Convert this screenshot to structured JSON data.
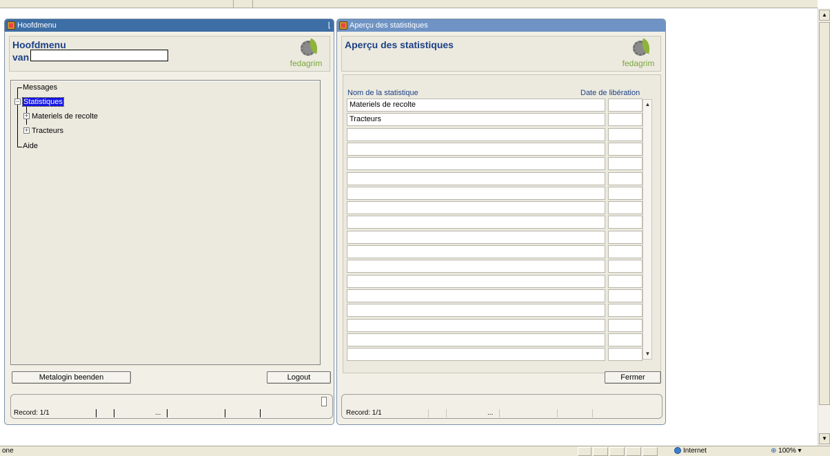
{
  "left_window": {
    "title": "Hoofdmenu",
    "heading_line1": "Hoofdmenu",
    "heading_line2": "van",
    "logo_text": "fedagrim",
    "tree": {
      "messages": "Messages",
      "statistiques": "Statistiques",
      "materiels": "Materiels de recolte",
      "tracteurs": "Tracteurs",
      "aide": "Aide"
    },
    "button_metalogin": "Metalogin beenden",
    "button_logout": "Logout",
    "record": "Record: 1/1",
    "record_dots": "..."
  },
  "right_window": {
    "title": "Aperçu des statistiques",
    "heading": "Aperçu des statistiques",
    "logo_text": "fedagrim",
    "col_name": "Nom de la  statistique",
    "col_date": "Date de libération",
    "rows": [
      {
        "name": "Materiels de recolte",
        "date": ""
      },
      {
        "name": "Tracteurs",
        "date": ""
      },
      {
        "name": "",
        "date": ""
      },
      {
        "name": "",
        "date": ""
      },
      {
        "name": "",
        "date": ""
      },
      {
        "name": "",
        "date": ""
      },
      {
        "name": "",
        "date": ""
      },
      {
        "name": "",
        "date": ""
      },
      {
        "name": "",
        "date": ""
      },
      {
        "name": "",
        "date": ""
      },
      {
        "name": "",
        "date": ""
      },
      {
        "name": "",
        "date": ""
      },
      {
        "name": "",
        "date": ""
      },
      {
        "name": "",
        "date": ""
      },
      {
        "name": "",
        "date": ""
      },
      {
        "name": "",
        "date": ""
      },
      {
        "name": "",
        "date": ""
      },
      {
        "name": "",
        "date": ""
      }
    ],
    "button_fermer": "Fermer",
    "record": "Record: 1/1",
    "record_dots": "..."
  },
  "statusbar": {
    "text": "one",
    "zone": "Internet",
    "zoom": "100%"
  }
}
